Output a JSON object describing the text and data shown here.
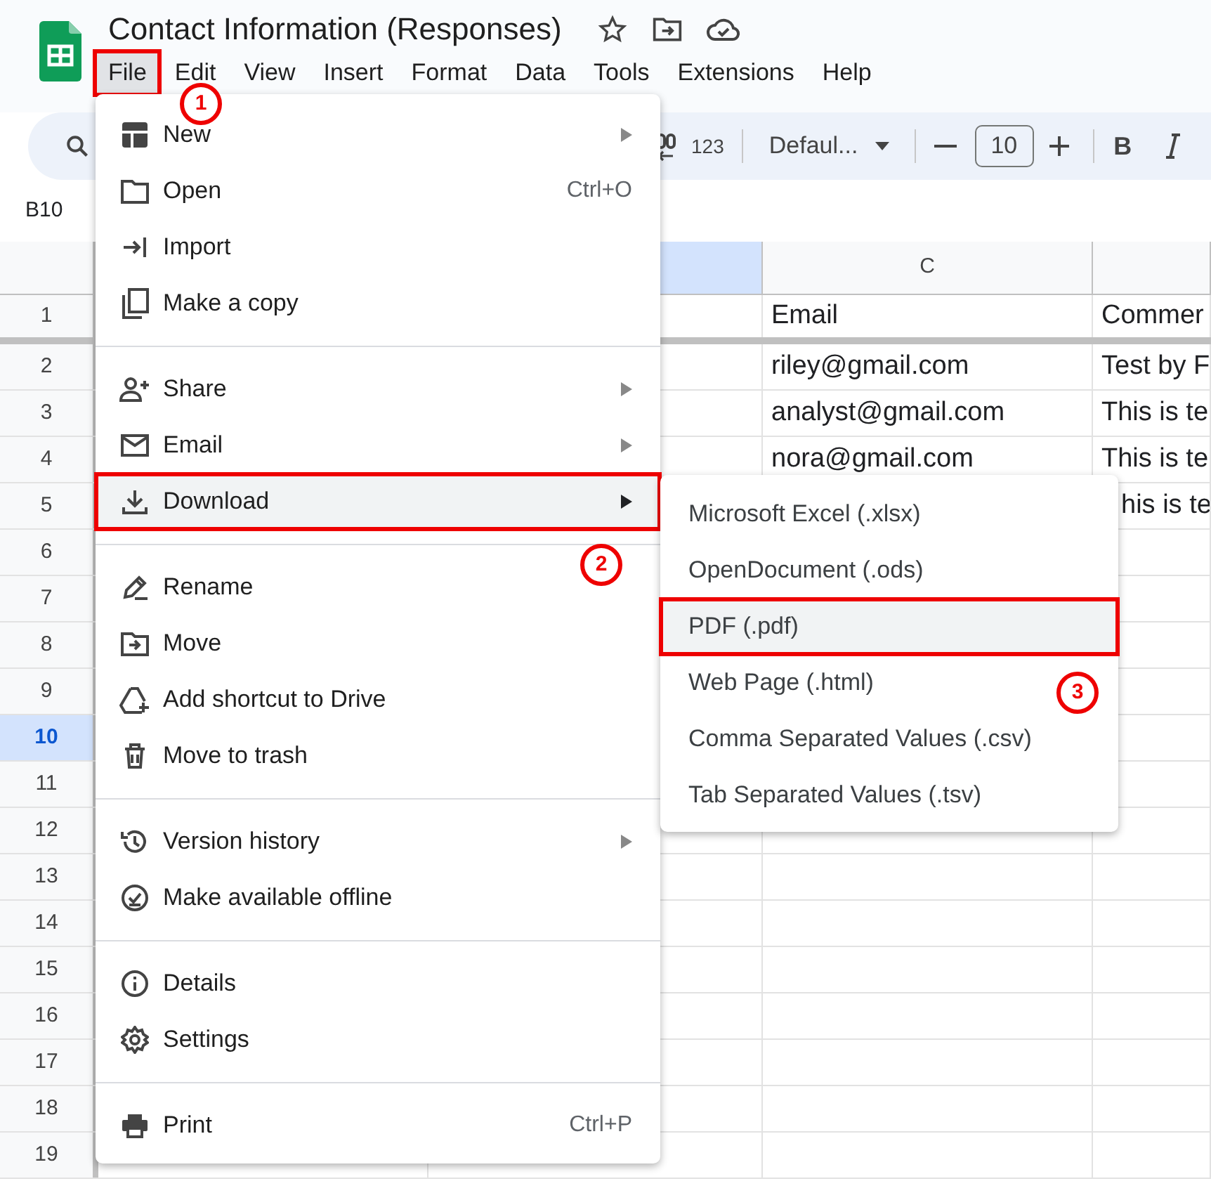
{
  "title": "Contact Information (Responses)",
  "menubar": [
    {
      "label": "File",
      "selected": true,
      "outlined": true
    },
    {
      "label": "Edit",
      "selected": false,
      "outlined": false
    },
    {
      "label": "View",
      "selected": false,
      "outlined": false
    },
    {
      "label": "Insert",
      "selected": false,
      "outlined": false
    },
    {
      "label": "Format",
      "selected": false,
      "outlined": false
    },
    {
      "label": "Data",
      "selected": false,
      "outlined": false
    },
    {
      "label": "Tools",
      "selected": false,
      "outlined": false
    },
    {
      "label": "Extensions",
      "selected": false,
      "outlined": false
    },
    {
      "label": "Help",
      "selected": false,
      "outlined": false
    }
  ],
  "toolbar": {
    "number_format": "123",
    "font": "Defaul...",
    "font_size": "10",
    "bold": "B"
  },
  "name_box": "B10",
  "columns": [
    {
      "selected": true
    },
    {
      "label": "C",
      "selected": false
    },
    {
      "selected": false
    }
  ],
  "rows": [
    {
      "number": "1",
      "selected": false,
      "c": "Email",
      "d": "Commer"
    },
    {
      "number": "2",
      "selected": false,
      "c": "riley@gmail.com",
      "d": "Test by F"
    },
    {
      "number": "3",
      "selected": false,
      "c": "analyst@gmail.com",
      "d": "This is te"
    },
    {
      "number": "4",
      "selected": false,
      "c": "nora@gmail.com",
      "d": "This is te"
    },
    {
      "number": "5",
      "selected": false,
      "d": "his is te"
    },
    {
      "number": "6",
      "selected": false
    },
    {
      "number": "7",
      "selected": false
    },
    {
      "number": "8",
      "selected": false
    },
    {
      "number": "9",
      "selected": false
    },
    {
      "number": "10",
      "selected": true
    },
    {
      "number": "11",
      "selected": false
    },
    {
      "number": "12",
      "selected": false
    },
    {
      "number": "13",
      "selected": false
    },
    {
      "number": "14",
      "selected": false
    },
    {
      "number": "15",
      "selected": false
    },
    {
      "number": "16",
      "selected": false
    },
    {
      "number": "17",
      "selected": false
    },
    {
      "number": "18",
      "selected": false
    },
    {
      "number": "19",
      "selected": false
    }
  ],
  "file_menu": [
    [
      {
        "label": "New",
        "submenu": true,
        "selected": false,
        "outlined": false
      },
      {
        "label": "Open",
        "shortcut": "Ctrl+O",
        "submenu": false,
        "selected": false,
        "outlined": false
      },
      {
        "label": "Import",
        "submenu": false,
        "selected": false,
        "outlined": false
      },
      {
        "label": "Make a copy",
        "submenu": false,
        "selected": false,
        "outlined": false
      }
    ],
    [
      {
        "label": "Share",
        "submenu": true,
        "selected": false,
        "outlined": false
      },
      {
        "label": "Email",
        "submenu": true,
        "selected": false,
        "outlined": false
      },
      {
        "label": "Download",
        "submenu": true,
        "selected": true,
        "outlined": true
      }
    ],
    [
      {
        "label": "Rename",
        "submenu": false,
        "selected": false,
        "outlined": false
      },
      {
        "label": "Move",
        "submenu": false,
        "selected": false,
        "outlined": false
      },
      {
        "label": "Add shortcut to Drive",
        "submenu": false,
        "selected": false,
        "outlined": false
      },
      {
        "label": "Move to trash",
        "submenu": false,
        "selected": false,
        "outlined": false
      }
    ],
    [
      {
        "label": "Version history",
        "submenu": true,
        "selected": false,
        "outlined": false
      },
      {
        "label": "Make available offline",
        "submenu": false,
        "selected": false,
        "outlined": false
      }
    ],
    [
      {
        "label": "Details",
        "submenu": false,
        "selected": false,
        "outlined": false
      },
      {
        "label": "Settings",
        "submenu": false,
        "selected": false,
        "outlined": false
      }
    ],
    [
      {
        "label": "Print",
        "shortcut": "Ctrl+P",
        "submenu": false,
        "selected": false,
        "outlined": false
      }
    ]
  ],
  "download_menu": [
    {
      "label": "Microsoft Excel (.xlsx)",
      "selected": false,
      "outlined": false
    },
    {
      "label": "OpenDocument (.ods)",
      "selected": false,
      "outlined": false
    },
    {
      "label": "PDF (.pdf)",
      "selected": true,
      "outlined": true
    },
    {
      "label": "Web Page (.html)",
      "selected": false,
      "outlined": false
    },
    {
      "label": "Comma Separated Values (.csv)",
      "selected": false,
      "outlined": false
    },
    {
      "label": "Tab Separated Values (.tsv)",
      "selected": false,
      "outlined": false
    }
  ],
  "step_markers": [
    "1",
    "2",
    "3"
  ]
}
